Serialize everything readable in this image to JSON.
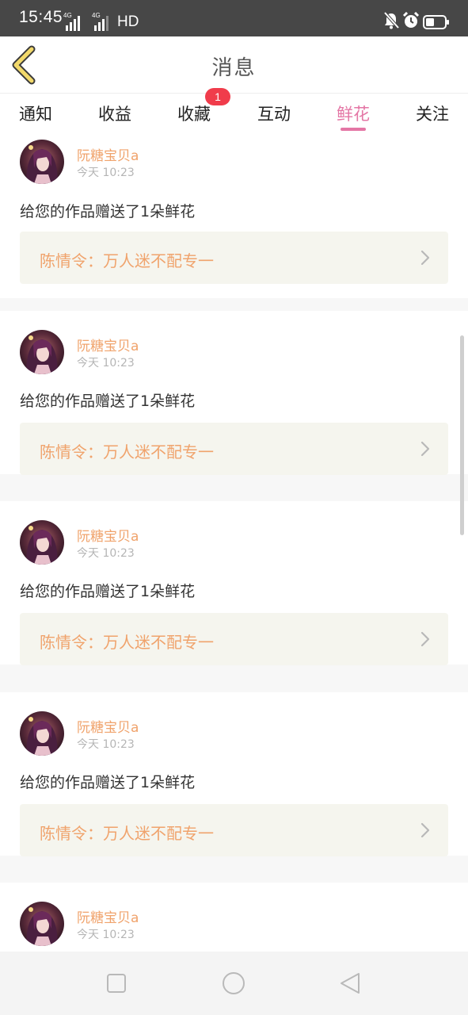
{
  "status_bar": {
    "time": "15:45",
    "signal1_label": "4G",
    "signal2_label": "4G",
    "hd_label": "HD",
    "icons": [
      "signal-icon",
      "signal-icon",
      "mute-bell-icon",
      "alarm-icon",
      "battery-icon"
    ]
  },
  "header": {
    "title": "消息",
    "back_icon": "back-chevron-icon"
  },
  "tabs": [
    {
      "label": "通知"
    },
    {
      "label": "收益"
    },
    {
      "label": "收藏",
      "badge": "1"
    },
    {
      "label": "互动"
    },
    {
      "label": "鲜花",
      "active": true
    },
    {
      "label": "关注"
    }
  ],
  "items": [
    {
      "name": "阮糖宝贝a",
      "time": "今天 10:23",
      "message": "给您的作品赠送了1朵鲜花",
      "work": "陈情令：万人迷不配专一"
    },
    {
      "name": "阮糖宝贝a",
      "time": "今天 10:23",
      "message": "给您的作品赠送了1朵鲜花",
      "work": "陈情令：万人迷不配专一"
    },
    {
      "name": "阮糖宝贝a",
      "time": "今天 10:23",
      "message": "给您的作品赠送了1朵鲜花",
      "work": "陈情令：万人迷不配专一"
    },
    {
      "name": "阮糖宝贝a",
      "time": "今天 10:23",
      "message": "给您的作品赠送了1朵鲜花",
      "work": "陈情令：万人迷不配专一"
    },
    {
      "name": "阮糖宝贝a",
      "time": "今天 10:23"
    }
  ],
  "colors": {
    "accent_pink": "#e476a5",
    "name_orange": "#f0a36c",
    "badge_red": "#f03c4b",
    "work_box_bg": "#f5f5ee"
  },
  "navbar": {
    "icons": [
      "recent-apps-icon",
      "home-icon",
      "back-triangle-icon"
    ]
  }
}
